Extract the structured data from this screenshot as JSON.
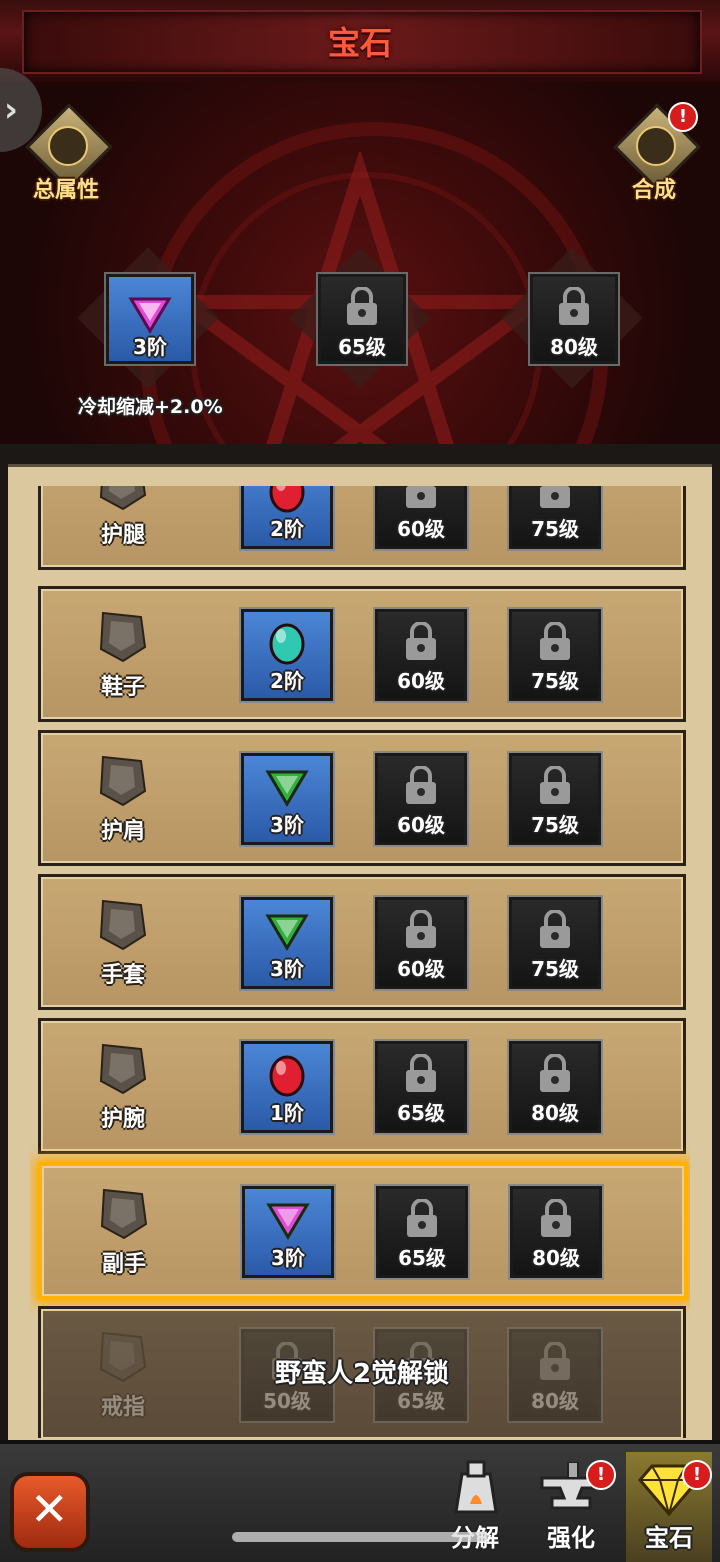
{
  "header": {
    "title": "宝石"
  },
  "hero": {
    "left_button_label": "总属性",
    "right_button_label": "合成",
    "right_badge": "!",
    "slots": [
      {
        "type": "gem",
        "gem_color": "#e04ad8",
        "label": "3阶"
      },
      {
        "type": "lock",
        "label": "65级"
      },
      {
        "type": "lock",
        "label": "80级"
      }
    ],
    "stat": "冷却缩减+2.0%"
  },
  "rows": [
    {
      "name": "护腿",
      "icon": "leggings-icon",
      "slots": [
        {
          "type": "gem",
          "gem_color": "#e02030",
          "label": "2阶"
        },
        {
          "type": "lock",
          "label": "60级"
        },
        {
          "type": "lock",
          "label": "75级"
        }
      ]
    },
    {
      "name": "鞋子",
      "icon": "boots-icon",
      "slots": [
        {
          "type": "gem",
          "gem_color": "#30c8b0",
          "label": "2阶"
        },
        {
          "type": "lock",
          "label": "60级"
        },
        {
          "type": "lock",
          "label": "75级"
        }
      ]
    },
    {
      "name": "护肩",
      "icon": "shoulder-icon",
      "slots": [
        {
          "type": "gem",
          "gem_color": "#30b040",
          "label": "3阶"
        },
        {
          "type": "lock",
          "label": "60级"
        },
        {
          "type": "lock",
          "label": "75级"
        }
      ]
    },
    {
      "name": "手套",
      "icon": "gloves-icon",
      "slots": [
        {
          "type": "gem",
          "gem_color": "#30b040",
          "label": "3阶"
        },
        {
          "type": "lock",
          "label": "60级"
        },
        {
          "type": "lock",
          "label": "75级"
        }
      ]
    },
    {
      "name": "护腕",
      "icon": "bracer-icon",
      "slots": [
        {
          "type": "gem",
          "gem_color": "#e02030",
          "label": "1阶"
        },
        {
          "type": "lock",
          "label": "65级"
        },
        {
          "type": "lock",
          "label": "80级"
        }
      ]
    },
    {
      "name": "副手",
      "icon": "offhand-icon",
      "selected": true,
      "slots": [
        {
          "type": "gem",
          "gem_color": "#e04ad8",
          "label": "3阶"
        },
        {
          "type": "lock",
          "label": "65级"
        },
        {
          "type": "lock",
          "label": "80级"
        }
      ]
    },
    {
      "name": "戒指",
      "icon": "ring-icon",
      "locked": true,
      "unlock_text": "野蛮人2觉解锁",
      "slots": [
        {
          "type": "lock",
          "label": "50级"
        },
        {
          "type": "lock",
          "label": "65级"
        },
        {
          "type": "lock",
          "label": "80级"
        }
      ]
    }
  ],
  "bottom_nav": {
    "close_icon": "close-icon",
    "items": [
      {
        "label": "分解",
        "icon": "forge-icon",
        "badge": ""
      },
      {
        "label": "强化",
        "icon": "anvil-icon",
        "badge": "!"
      },
      {
        "label": "宝石",
        "icon": "gem-icon",
        "badge": "!",
        "active": true
      }
    ]
  },
  "colors": {
    "accent": "#ff5a3a",
    "selected_border": "#ffb300",
    "badge": "#d81c1c"
  }
}
